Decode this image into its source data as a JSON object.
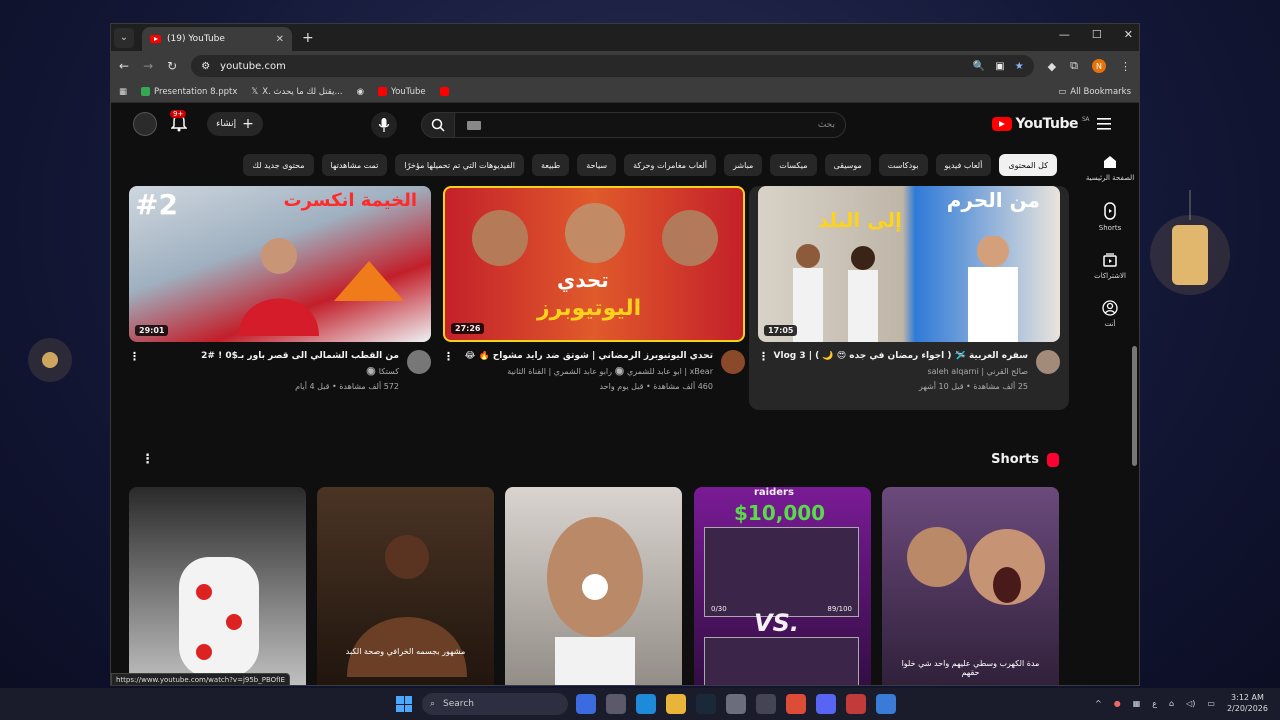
{
  "browser": {
    "tab_title": "(19) YouTube",
    "url": "youtube.com",
    "bookmarks": [
      {
        "label": "Presentation 8.pptx",
        "color": "#34a853"
      },
      {
        "label": "X. يقتل لك ما يحدث...",
        "color": "#ffffff"
      },
      {
        "label": "",
        "color": "#ffffff"
      },
      {
        "label": "YouTube",
        "color": "#ff0000"
      },
      {
        "label": "",
        "color": "#ff0000"
      }
    ],
    "all_bookmarks": "All Bookmarks",
    "profile_initial": "N"
  },
  "youtube": {
    "logo_text": "YouTube",
    "country": "SA",
    "search_placeholder": "بحث",
    "create_label": "إنشاء",
    "notification_count": "9+",
    "chips": [
      {
        "label": "كل المحتوى",
        "active": true
      },
      {
        "label": "ألعاب فيديو",
        "active": false
      },
      {
        "label": "بودكاست",
        "active": false
      },
      {
        "label": "موسيقى",
        "active": false
      },
      {
        "label": "ميكسات",
        "active": false
      },
      {
        "label": "مباشر",
        "active": false
      },
      {
        "label": "ألعاب مغامرات وحركة",
        "active": false
      },
      {
        "label": "سياحة",
        "active": false
      },
      {
        "label": "طبيعة",
        "active": false
      },
      {
        "label": "الفيديوهات التي تم تحميلها مؤخرًا",
        "active": false
      },
      {
        "label": "تمت مشاهدتها",
        "active": false
      },
      {
        "label": "محتوى جديد لك",
        "active": false
      }
    ],
    "sidenav": [
      {
        "label": "الصفحة الرئيسية",
        "icon": "home-icon"
      },
      {
        "label": "Shorts",
        "icon": "shorts-icon"
      },
      {
        "label": "الاشتراكات",
        "icon": "subscriptions-icon"
      },
      {
        "label": "أنت",
        "icon": "you-icon"
      }
    ],
    "videos": [
      {
        "title": "سفره العربية 🛩️ ( اجواء رمضان في جده 😍 🌙 ) | Vlog 3",
        "channel": "صالح القرني | saleh alqarni",
        "meta": "25 ألف مشاهدة • قبل 10 أشهر",
        "duration": "17:05"
      },
      {
        "title": "تحدي اليوتيوبرز الرمضاني | شوتق ضد رايد مشواح 🔥 😂",
        "channel": "xBear | ابو عابد للشمري 🔘 رابو عابد الشمري | القناة الثانية",
        "meta": "460 ألف مشاهدة • قبل يوم واحد",
        "duration": "27:26"
      },
      {
        "title": "من القطب الشمالي الى قصر باور بـ$0 ! #2",
        "channel": "كستكا 🔘",
        "meta": "572 ألف مشاهدة • قبل 4 أيام",
        "duration": "29:01"
      }
    ],
    "thumb_overlays": {
      "v1_a": "من الحرم",
      "v1_b": "إلى البلد",
      "v2_a": "تحدي",
      "v2_b": "اليوتيوبرز",
      "v3_a": "الخيمة انكسرت",
      "v3_b": "#2"
    },
    "shorts_title": "Shorts",
    "shorts": [
      {
        "caption": "",
        "colors": [
          "#2a2a2a",
          "#d0d0d0"
        ]
      },
      {
        "caption": "مشهور بجسمه الخرافي وصحة الكبد",
        "colors": [
          "#4a3424",
          "#1c120c"
        ]
      },
      {
        "caption": "",
        "colors": [
          "#d9d4cf",
          "#8c8680"
        ]
      },
      {
        "caption": "$10,000",
        "colors": [
          "#7a1b96",
          "#2b0c3a"
        ]
      },
      {
        "caption": "مدة الكهرب وسطي عليهم واحد شي خلوا حقهم",
        "colors": [
          "#6b4a7c",
          "#2a1c33"
        ]
      }
    ],
    "shorts_extra": {
      "raiders": "raiders",
      "ammo_left": "0/30",
      "ammo_right": "89/100",
      "vs": "VS."
    },
    "status_url": "https://www.youtube.com/watch?v=j95b_PBOfIE"
  },
  "taskbar": {
    "search_label": "Search",
    "lang": "ع",
    "time": "3:12 AM",
    "date": "2/20/2026"
  }
}
